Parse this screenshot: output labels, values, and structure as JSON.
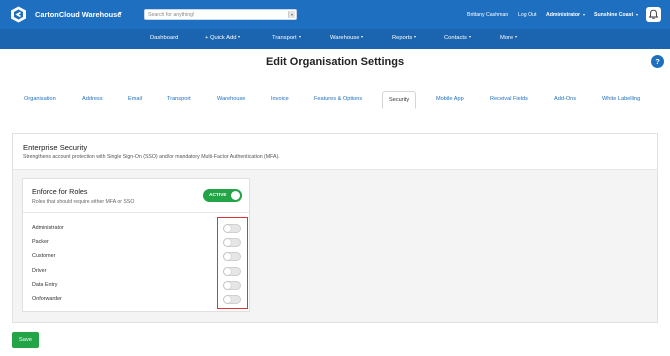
{
  "header": {
    "brand": "CartonCloud Warehouse",
    "search_placeholder": "Search for anything!",
    "user_name": "Brittany Cashman",
    "logout": "Log Out",
    "role": "Administrator",
    "location": "Sunshine Coast",
    "icons": {
      "logo": "cartoncloud-logo-icon",
      "bell": "bell-icon",
      "dropdown": "chevron-down-icon"
    }
  },
  "nav": {
    "items": [
      "Dashboard",
      "+ Quick Add",
      "Transport",
      "Warehouse",
      "Reports",
      "Contacts",
      "More"
    ]
  },
  "page": {
    "title": "Edit Organisation Settings",
    "help": "?"
  },
  "tabs": {
    "items": [
      "Organisation",
      "Address",
      "Email",
      "Transport",
      "Warehouse",
      "Invoice",
      "Features & Options",
      "Security",
      "Mobile App",
      "Receival Fields",
      "Add-Ons",
      "White Labelling"
    ],
    "active": "Security"
  },
  "section": {
    "title": "Enterprise Security",
    "description": "Strengthens account protection with Single Sign-On (SSO) and/or mandatory Multi-Factor Authentication (MFA)."
  },
  "enforce": {
    "title": "Enforce for Roles",
    "description": "Roles that should require either MFA or SSO",
    "toggle_label": "ACTIVE",
    "toggle_on": true
  },
  "roles": [
    {
      "name": "Administrator",
      "enabled": false
    },
    {
      "name": "Packer",
      "enabled": false
    },
    {
      "name": "Customer",
      "enabled": false
    },
    {
      "name": "Driver",
      "enabled": false
    },
    {
      "name": "Data Entry",
      "enabled": false
    },
    {
      "name": "Onforwarder",
      "enabled": false
    }
  ],
  "actions": {
    "save": "Save"
  },
  "colors": {
    "header_bg": "#1f6fc0",
    "nav_bg": "#1a64b0",
    "accent": "#1f6fc0",
    "success": "#22a447",
    "highlight": "#e03535"
  }
}
